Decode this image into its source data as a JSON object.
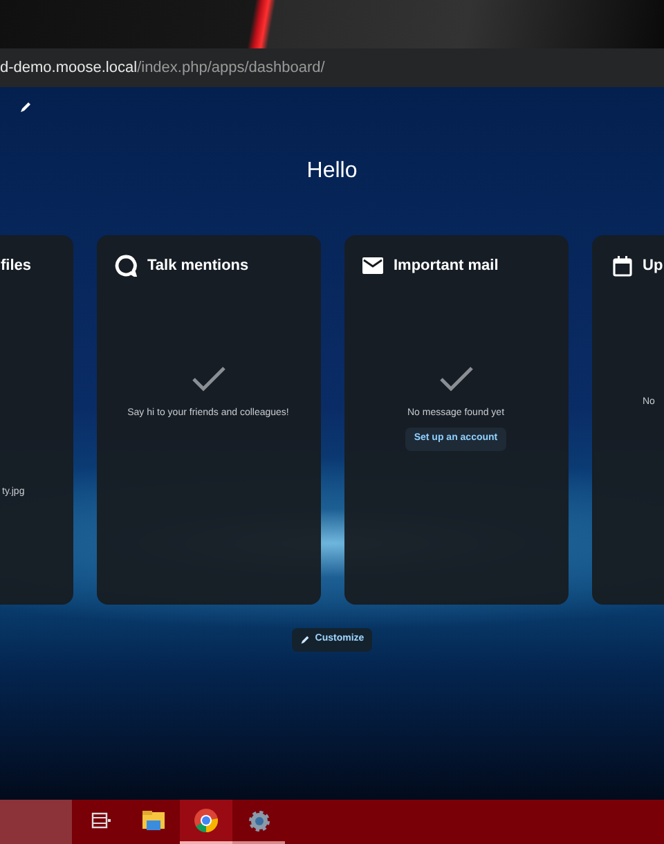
{
  "address_bar": {
    "host": "d-demo.moose.local",
    "path": "/index.php/apps/dashboard/"
  },
  "greeting": "Hello",
  "widgets": [
    {
      "kind": "files",
      "title": "files",
      "lines": [
        "ty.jpg"
      ]
    },
    {
      "kind": "talk",
      "title": "Talk mentions",
      "empty": true,
      "message": "Say hi to your friends and colleagues!"
    },
    {
      "kind": "mail",
      "title": "Important mail",
      "empty": true,
      "message": "No message found yet",
      "action": "Set up an account"
    },
    {
      "kind": "calendar",
      "title": "Up",
      "lines": [
        "No"
      ]
    }
  ],
  "customize_button": "Customize",
  "taskbar": {
    "apps": [
      {
        "kind": "task-view",
        "active": false
      },
      {
        "kind": "folder",
        "active": false
      },
      {
        "kind": "browser",
        "active": true
      },
      {
        "kind": "settings",
        "active": false
      }
    ]
  }
}
